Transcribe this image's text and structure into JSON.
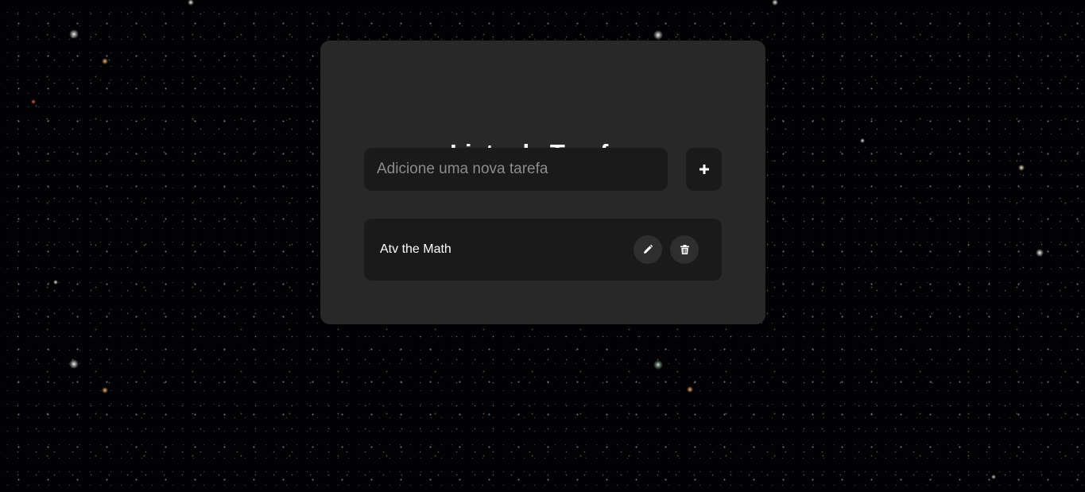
{
  "app": {
    "title": "Lista de Tarefas"
  },
  "input": {
    "placeholder": "Adicione uma nova tarefa",
    "value": ""
  },
  "add_button": {
    "icon": "plus-icon"
  },
  "tasks": [
    {
      "text": "Atv the Math",
      "edit_icon": "pencil-icon",
      "delete_icon": "trash-icon"
    }
  ],
  "colors": {
    "card": "#282828",
    "field": "#1a1a1a",
    "round_button": "#2e2e2e",
    "text": "#ffffff",
    "placeholder": "#8c8c8c"
  }
}
